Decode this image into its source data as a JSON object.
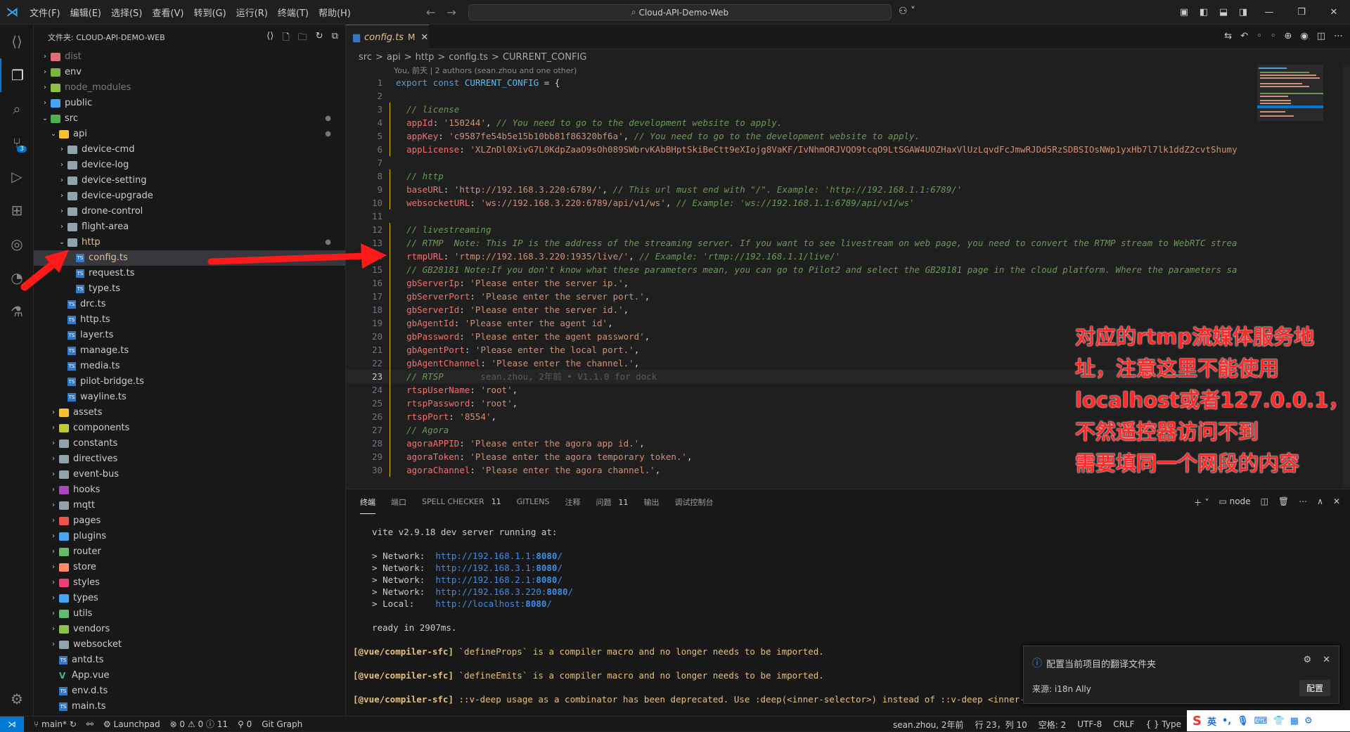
{
  "titlebar": {
    "menus": [
      "文件(F)",
      "编辑(E)",
      "选择(S)",
      "查看(V)",
      "转到(G)",
      "运行(R)",
      "终端(T)",
      "帮助(H)"
    ],
    "search_text": "Cloud-API-Demo-Web"
  },
  "activitybar": {
    "scm_badge": "3"
  },
  "explorer": {
    "header": "文件夹: CLOUD-API-DEMO-WEB",
    "rows": [
      {
        "label": "dist",
        "type": "folder",
        "depth": 0,
        "open": false,
        "dim": true,
        "icon": "#e06c75"
      },
      {
        "label": "env",
        "type": "folder",
        "depth": 0,
        "open": false,
        "icon": "#7cb342"
      },
      {
        "label": "node_modules",
        "type": "folder",
        "depth": 0,
        "open": false,
        "dim": true,
        "icon": "#8bc34a"
      },
      {
        "label": "public",
        "type": "folder",
        "depth": 0,
        "open": false,
        "icon": "#42a5f5"
      },
      {
        "label": "src",
        "type": "folder",
        "depth": 0,
        "open": true,
        "icon": "#4caf50",
        "mod": true
      },
      {
        "label": "api",
        "type": "folder",
        "depth": 1,
        "open": true,
        "icon": "#fbc02d",
        "mod": true
      },
      {
        "label": "device-cmd",
        "type": "folder",
        "depth": 2,
        "open": false,
        "icon": "#90a4ae"
      },
      {
        "label": "device-log",
        "type": "folder",
        "depth": 2,
        "open": false,
        "icon": "#90a4ae"
      },
      {
        "label": "device-setting",
        "type": "folder",
        "depth": 2,
        "open": false,
        "icon": "#90a4ae"
      },
      {
        "label": "device-upgrade",
        "type": "folder",
        "depth": 2,
        "open": false,
        "icon": "#90a4ae"
      },
      {
        "label": "drone-control",
        "type": "folder",
        "depth": 2,
        "open": false,
        "icon": "#90a4ae"
      },
      {
        "label": "flight-area",
        "type": "folder",
        "depth": 2,
        "open": false,
        "icon": "#90a4ae"
      },
      {
        "label": "http",
        "type": "folder",
        "depth": 2,
        "open": true,
        "icon": "#90a4ae",
        "mod": true,
        "orange": true
      },
      {
        "label": "config.ts",
        "type": "ts",
        "depth": 3,
        "selected": true,
        "orange": true
      },
      {
        "label": "request.ts",
        "type": "ts",
        "depth": 3
      },
      {
        "label": "type.ts",
        "type": "ts",
        "depth": 3
      },
      {
        "label": "drc.ts",
        "type": "ts",
        "depth": 2
      },
      {
        "label": "http.ts",
        "type": "ts",
        "depth": 2
      },
      {
        "label": "layer.ts",
        "type": "ts",
        "depth": 2
      },
      {
        "label": "manage.ts",
        "type": "ts",
        "depth": 2
      },
      {
        "label": "media.ts",
        "type": "ts",
        "depth": 2
      },
      {
        "label": "pilot-bridge.ts",
        "type": "ts",
        "depth": 2
      },
      {
        "label": "wayline.ts",
        "type": "ts",
        "depth": 2
      },
      {
        "label": "assets",
        "type": "folder",
        "depth": 1,
        "open": false,
        "icon": "#fbc02d"
      },
      {
        "label": "components",
        "type": "folder",
        "depth": 1,
        "open": false,
        "icon": "#c0ca33"
      },
      {
        "label": "constants",
        "type": "folder",
        "depth": 1,
        "open": false,
        "icon": "#90a4ae"
      },
      {
        "label": "directives",
        "type": "folder",
        "depth": 1,
        "open": false,
        "icon": "#90a4ae"
      },
      {
        "label": "event-bus",
        "type": "folder",
        "depth": 1,
        "open": false,
        "icon": "#90a4ae"
      },
      {
        "label": "hooks",
        "type": "folder",
        "depth": 1,
        "open": false,
        "icon": "#ab47bc"
      },
      {
        "label": "mqtt",
        "type": "folder",
        "depth": 1,
        "open": false,
        "icon": "#90a4ae"
      },
      {
        "label": "pages",
        "type": "folder",
        "depth": 1,
        "open": false,
        "icon": "#ef5350"
      },
      {
        "label": "plugins",
        "type": "folder",
        "depth": 1,
        "open": false,
        "icon": "#42a5f5"
      },
      {
        "label": "router",
        "type": "folder",
        "depth": 1,
        "open": false,
        "icon": "#66bb6a"
      },
      {
        "label": "store",
        "type": "folder",
        "depth": 1,
        "open": false,
        "icon": "#ff8a65"
      },
      {
        "label": "styles",
        "type": "folder",
        "depth": 1,
        "open": false,
        "icon": "#ec407a"
      },
      {
        "label": "types",
        "type": "folder",
        "depth": 1,
        "open": false,
        "icon": "#42a5f5"
      },
      {
        "label": "utils",
        "type": "folder",
        "depth": 1,
        "open": false,
        "icon": "#66bb6a"
      },
      {
        "label": "vendors",
        "type": "folder",
        "depth": 1,
        "open": false,
        "icon": "#8bc34a"
      },
      {
        "label": "websocket",
        "type": "folder",
        "depth": 1,
        "open": false,
        "icon": "#90a4ae"
      },
      {
        "label": "antd.ts",
        "type": "ts",
        "depth": 1
      },
      {
        "label": "App.vue",
        "type": "vue",
        "depth": 1
      },
      {
        "label": "env.d.ts",
        "type": "ts",
        "depth": 1
      },
      {
        "label": "main.ts",
        "type": "ts",
        "depth": 1
      }
    ]
  },
  "editor": {
    "tab_label": "config.ts",
    "tab_status": "M",
    "breadcrumb": [
      "src",
      "api",
      "http",
      "config.ts",
      "CURRENT_CONFIG"
    ],
    "codelens": "You, 前天 | 2 authors (sean.zhou and one other)",
    "current_line": 23,
    "lines": [
      [
        [
          "kw",
          "export "
        ],
        [
          "kw",
          "const "
        ],
        [
          "cn",
          "CURRENT_CONFIG"
        ],
        [
          "pun",
          " = {"
        ]
      ],
      [],
      [
        [
          "pun",
          "  "
        ],
        [
          "com",
          "// license"
        ]
      ],
      [
        [
          "pun",
          "  "
        ],
        [
          "key",
          "appId"
        ],
        [
          "pun",
          ": "
        ],
        [
          "str",
          "'150244'"
        ],
        [
          "pun",
          ", "
        ],
        [
          "com",
          "// You need to go to the development website to apply."
        ]
      ],
      [
        [
          "pun",
          "  "
        ],
        [
          "key",
          "appKey"
        ],
        [
          "pun",
          ": "
        ],
        [
          "str",
          "'c9587fe54b5e15b10bb81f86320bf6a'"
        ],
        [
          "pun",
          ", "
        ],
        [
          "com",
          "// You need to go to the development website to apply."
        ]
      ],
      [
        [
          "pun",
          "  "
        ],
        [
          "key",
          "appLicense"
        ],
        [
          "pun",
          ": "
        ],
        [
          "str",
          "'XLZnDl0XivG7L0KdpZaaO9sOh089SWbrvKAbBHptSkiBeCtt9eXIojg8VaKF/IvNhmORJVQO9tcqO9LtSGAW4UOZHaxVlUzLqvdFcJmwRJDd5RzSDBSIOsNWp1yxHb7l7lk1ddZ2cvtShumy"
        ]
      ],
      [],
      [
        [
          "pun",
          "  "
        ],
        [
          "com",
          "// http"
        ]
      ],
      [
        [
          "pun",
          "  "
        ],
        [
          "key",
          "baseURL"
        ],
        [
          "pun",
          ": "
        ],
        [
          "str",
          "'http://192.168.3.220:6789/'"
        ],
        [
          "pun",
          ", "
        ],
        [
          "com",
          "// This url must end with \"/\". Example: 'http://192.168.1.1:6789/'"
        ]
      ],
      [
        [
          "pun",
          "  "
        ],
        [
          "key",
          "websocketURL"
        ],
        [
          "pun",
          ": "
        ],
        [
          "str",
          "'ws://192.168.3.220:6789/api/v1/ws'"
        ],
        [
          "pun",
          ", "
        ],
        [
          "com",
          "// Example: 'ws://192.168.1.1:6789/api/v1/ws'"
        ]
      ],
      [],
      [
        [
          "pun",
          "  "
        ],
        [
          "com",
          "// livestreaming"
        ]
      ],
      [
        [
          "pun",
          "  "
        ],
        [
          "com",
          "// RTMP  Note: This IP is the address of the streaming server. If you want to see livestream on web page, you need to convert the RTMP stream to WebRTC strea"
        ]
      ],
      [
        [
          "pun",
          "  "
        ],
        [
          "key",
          "rtmpURL"
        ],
        [
          "pun",
          ": "
        ],
        [
          "str",
          "'rtmp://192.168.3.220:1935/live/'"
        ],
        [
          "pun",
          ", "
        ],
        [
          "com",
          "// Example: 'rtmp://192.168.1.1/live/'"
        ]
      ],
      [
        [
          "pun",
          "  "
        ],
        [
          "com",
          "// GB28181 Note:If you don't know what these parameters mean, you can go to Pilot2 and select the GB28181 page in the cloud platform. Where the parameters sa"
        ]
      ],
      [
        [
          "pun",
          "  "
        ],
        [
          "key",
          "gbServerIp"
        ],
        [
          "pun",
          ": "
        ],
        [
          "str",
          "'Please enter the server ip.'"
        ],
        [
          "pun",
          ","
        ]
      ],
      [
        [
          "pun",
          "  "
        ],
        [
          "key",
          "gbServerPort"
        ],
        [
          "pun",
          ": "
        ],
        [
          "str",
          "'Please enter the server port.'"
        ],
        [
          "pun",
          ","
        ]
      ],
      [
        [
          "pun",
          "  "
        ],
        [
          "key",
          "gbServerId"
        ],
        [
          "pun",
          ": "
        ],
        [
          "str",
          "'Please enter the server id.'"
        ],
        [
          "pun",
          ","
        ]
      ],
      [
        [
          "pun",
          "  "
        ],
        [
          "key",
          "gbAgentId"
        ],
        [
          "pun",
          ": "
        ],
        [
          "str",
          "'Please enter the agent id'"
        ],
        [
          "pun",
          ","
        ]
      ],
      [
        [
          "pun",
          "  "
        ],
        [
          "key",
          "gbPassword"
        ],
        [
          "pun",
          ": "
        ],
        [
          "str",
          "'Please enter the agent password'"
        ],
        [
          "pun",
          ","
        ]
      ],
      [
        [
          "pun",
          "  "
        ],
        [
          "key",
          "gbAgentPort"
        ],
        [
          "pun",
          ": "
        ],
        [
          "str",
          "'Please enter the local port.'"
        ],
        [
          "pun",
          ","
        ]
      ],
      [
        [
          "pun",
          "  "
        ],
        [
          "key",
          "gbAgentChannel"
        ],
        [
          "pun",
          ": "
        ],
        [
          "str",
          "'Please enter the channel.'"
        ],
        [
          "pun",
          ","
        ]
      ],
      [
        [
          "pun",
          "  "
        ],
        [
          "com",
          "// RTSP"
        ],
        [
          "lineblame",
          "       sean.zhou, 2年前 • V1.1.0 for dock"
        ]
      ],
      [
        [
          "pun",
          "  "
        ],
        [
          "key",
          "rtspUserName"
        ],
        [
          "pun",
          ": "
        ],
        [
          "str",
          "'root'"
        ],
        [
          "pun",
          ","
        ]
      ],
      [
        [
          "pun",
          "  "
        ],
        [
          "key",
          "rtspPassword"
        ],
        [
          "pun",
          ": "
        ],
        [
          "str",
          "'root'"
        ],
        [
          "pun",
          ","
        ]
      ],
      [
        [
          "pun",
          "  "
        ],
        [
          "key",
          "rtspPort"
        ],
        [
          "pun",
          ": "
        ],
        [
          "str",
          "'8554'"
        ],
        [
          "pun",
          ","
        ]
      ],
      [
        [
          "pun",
          "  "
        ],
        [
          "com",
          "// Agora"
        ]
      ],
      [
        [
          "pun",
          "  "
        ],
        [
          "key",
          "agoraAPPID"
        ],
        [
          "pun",
          ": "
        ],
        [
          "str",
          "'Please enter the agora app id.'"
        ],
        [
          "pun",
          ","
        ]
      ],
      [
        [
          "pun",
          "  "
        ],
        [
          "key",
          "agoraToken"
        ],
        [
          "pun",
          ": "
        ],
        [
          "str",
          "'Please enter the agora temporary token.'"
        ],
        [
          "pun",
          ","
        ]
      ],
      [
        [
          "pun",
          "  "
        ],
        [
          "key",
          "agoraChannel"
        ],
        [
          "pun",
          ": "
        ],
        [
          "str",
          "'Please enter the agora channel.'"
        ],
        [
          "pun",
          ","
        ]
      ],
      []
    ]
  },
  "annotation": {
    "lines": [
      "对应的rtmp流媒体服务地址，注意这里不能使用",
      "localhost或者127.0.0.1，不然遥控器访问不到",
      "需要填同一个网段的内容"
    ]
  },
  "panel": {
    "tabs": [
      {
        "label": "终端",
        "active": true
      },
      {
        "label": "端口"
      },
      {
        "label": "SPELL CHECKER",
        "count": "11"
      },
      {
        "label": "GITLENS"
      },
      {
        "label": "注释"
      },
      {
        "label": "问题",
        "count": "11"
      },
      {
        "label": "输出"
      },
      {
        "label": "调试控制台"
      }
    ],
    "terminal_name": "node",
    "terminal": {
      "vite": "  vite v2.9.18 dev server running at:",
      "networks": [
        {
          "label": "  > Network:  ",
          "url": "http://192.168.1.1:",
          "port": "8080",
          "tail": "/"
        },
        {
          "label": "  > Network:  ",
          "url": "http://192.168.3.1:",
          "port": "8080",
          "tail": "/"
        },
        {
          "label": "  > Network:  ",
          "url": "http://192.168.2.1:",
          "port": "8080",
          "tail": "/"
        },
        {
          "label": "  > Network:  ",
          "url": "http://192.168.3.220:",
          "port": "8080",
          "tail": "/"
        },
        {
          "label": "  > Local:    ",
          "url": "http://localhost:",
          "port": "8080",
          "tail": "/"
        }
      ],
      "ready": "  ready in 2907ms.",
      "warnings": [
        {
          "prefix": "[@vue/compiler-sfc]",
          "msg": " `defineProps` is a compiler macro and no longer needs to be imported."
        },
        {
          "prefix": "[@vue/compiler-sfc]",
          "msg": " `defineEmits` is a compiler macro and no longer needs to be imported."
        },
        {
          "prefix": "[@vue/compiler-sfc]",
          "msg": " ::v-deep usage as a combinator has been deprecated. Use :deep(<inner-selector>) instead of ::v-deep <inner-selector>."
        }
      ]
    }
  },
  "notification": {
    "title": "配置当前项目的翻译文件夹",
    "source": "来源: i18n Ally",
    "button": "配置"
  },
  "statusbar": {
    "branch": "main*",
    "launchpad": "Launchpad",
    "problems": "⊗ 0 ⚠ 0 ⓘ 11",
    "ports": "⚲ 0",
    "gitgraph": "Git Graph",
    "blame": "sean.zhou, 2年前",
    "position": "行 23，列 10",
    "spaces": "空格: 2",
    "encoding": "UTF-8",
    "eol": "CRLF",
    "lang": "{ } Type"
  },
  "ime": {
    "lang": "英"
  }
}
